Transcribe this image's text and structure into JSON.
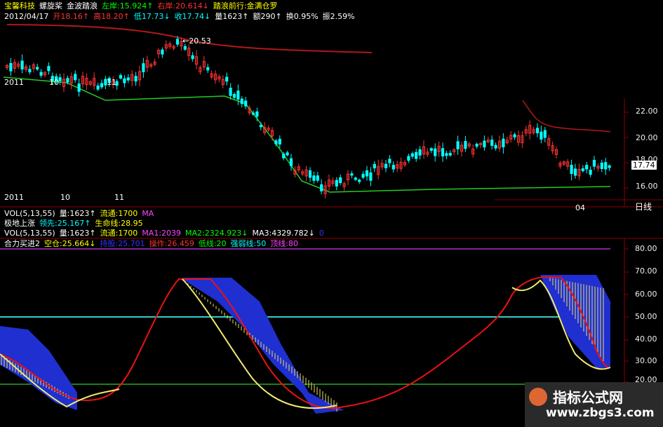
{
  "header": {
    "line1": [
      {
        "text": "宝馨科技",
        "color": "#ffff00"
      },
      {
        "text": "螺旋桨",
        "color": "#ffffff"
      },
      {
        "text": "金波踏浪",
        "color": "#ffffff"
      },
      {
        "text": "左岸:15.924↑",
        "color": "#00ff00"
      },
      {
        "text": "右岸:20.614↓",
        "color": "#ff3333"
      },
      {
        "text": "踏浪前行:金满仓罗",
        "color": "#ffff00"
      }
    ],
    "line2": [
      {
        "text": "2012/04/17",
        "color": "#ffffff"
      },
      {
        "text": "开18.16↑",
        "color": "#ff3333"
      },
      {
        "text": "高18.20↑",
        "color": "#ff3333"
      },
      {
        "text": "低17.73↓",
        "color": "#00ffff"
      },
      {
        "text": "收17.74↓",
        "color": "#00ffff"
      },
      {
        "text": "量1623↑",
        "color": "#ffffff"
      },
      {
        "text": "额290↑",
        "color": "#ffffff"
      },
      {
        "text": "换0.95%",
        "color": "#ffffff"
      },
      {
        "text": "振2.59%",
        "color": "#ffffff"
      }
    ]
  },
  "price_panel": {
    "peak_label": "20.53",
    "last_price": "17.74",
    "y_ticks": [
      "22.00",
      "20.00",
      "18.00",
      "16.00"
    ],
    "x_labels_top": [
      "2011",
      "10",
      "11"
    ],
    "x_labels_bottom": [
      "2011",
      "10",
      "11",
      "04"
    ],
    "axis_unit": "日线"
  },
  "indicator_lines": {
    "vol1": [
      {
        "text": "VOL(5,13,55)",
        "color": "#ffffff"
      },
      {
        "text": "量:1623↑",
        "color": "#ffffff"
      },
      {
        "text": "流通:1700",
        "color": "#ffff00"
      },
      {
        "text": "MA",
        "color": "#ff44ff"
      }
    ],
    "jdsz": [
      {
        "text": "极地上涨",
        "color": "#ffffff"
      },
      {
        "text": "领先:25.167↑",
        "color": "#00ffff"
      },
      {
        "text": "生命线:28.95",
        "color": "#ffff00"
      }
    ],
    "vol2": [
      {
        "text": "VOL(5,13,55)",
        "color": "#ffffff"
      },
      {
        "text": "量:1623↑",
        "color": "#ffffff"
      },
      {
        "text": "流通:1700",
        "color": "#ffff00"
      },
      {
        "text": "MA1:2039",
        "color": "#ff44ff"
      },
      {
        "text": "MA2:2324.923↓",
        "color": "#00ff00"
      },
      {
        "text": "MA3:4329.782↓",
        "color": "#ffffff"
      },
      {
        "text": "0",
        "color": "#3333ff"
      }
    ],
    "hlmj": [
      {
        "text": "合力买进2",
        "color": "#ffffff"
      },
      {
        "text": "空仓:25.664↓",
        "color": "#ffff00"
      },
      {
        "text": "持股:25.701",
        "color": "#3333ff"
      },
      {
        "text": "操作:26.459",
        "color": "#ff3333"
      },
      {
        "text": "低线:20",
        "color": "#00ff00"
      },
      {
        "text": "强弱线:50",
        "color": "#00ffff"
      },
      {
        "text": "顶线:80",
        "color": "#ff44ff"
      }
    ]
  },
  "osc_panel": {
    "y_ticks": [
      "80.00",
      "70.00",
      "60.00",
      "50.00",
      "40.00",
      "30.00",
      "20.00"
    ]
  },
  "watermark": {
    "line1": "指标公式网",
    "line2": "www.zbgs3.com"
  },
  "colors": {
    "up": "#ff3333",
    "down": "#00ffff",
    "ma_long": "#b01818",
    "support": "#22cc22",
    "grid": "#8b0000"
  }
}
